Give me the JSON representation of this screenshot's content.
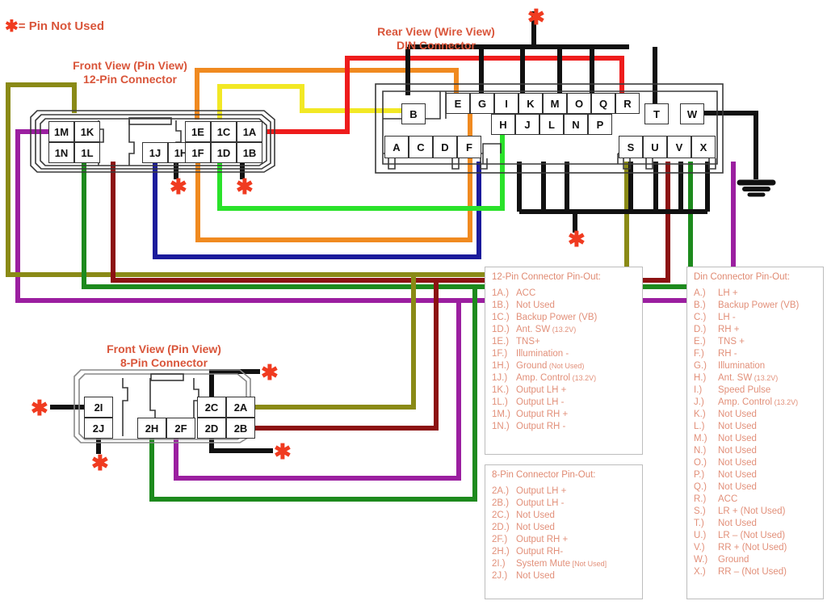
{
  "legend_note": {
    "symbol": "✱",
    "text": "= Pin Not Used"
  },
  "titles": {
    "twelve_pin": [
      "Front View (Pin View)",
      "12-Pin Connector"
    ],
    "din": [
      "Rear View (Wire View)",
      "DIN Connector"
    ],
    "eight_pin": [
      "Front View (Pin View)",
      "8-Pin Connector"
    ]
  },
  "connectors": {
    "twelve_pin": {
      "name": "12-Pin Connector",
      "pins": [
        "1M",
        "1K",
        "1N",
        "1L",
        "1J",
        "1H",
        "1E",
        "1C",
        "1A",
        "1F",
        "1D",
        "1B"
      ]
    },
    "din": {
      "name": "DIN Connector",
      "row_top": [
        "E",
        "G",
        "I",
        "K",
        "M",
        "O",
        "Q",
        "R"
      ],
      "row_top_right": [
        "T",
        "W"
      ],
      "row_mid_left": [
        "B"
      ],
      "row_mid": [
        "H",
        "J",
        "L",
        "N",
        "P"
      ],
      "row_bottom_left": [
        "A",
        "C",
        "D",
        "F"
      ],
      "row_bottom_right": [
        "S",
        "U",
        "V",
        "X"
      ]
    },
    "eight_pin": {
      "name": "8-Pin Connector",
      "pins": [
        "2I",
        "2J",
        "2H",
        "2F",
        "2C",
        "2A",
        "2D",
        "2B"
      ]
    }
  },
  "pinouts": {
    "twelve_pin": {
      "title": "12-Pin Connector Pin-Out:",
      "rows": [
        {
          "key": "1A.)",
          "val": "ACC",
          "note": ""
        },
        {
          "key": "1B.)",
          "val": "Not Used",
          "note": ""
        },
        {
          "key": "1C.)",
          "val": "Backup Power (VB)",
          "note": ""
        },
        {
          "key": "1D.)",
          "val": "Ant. SW",
          "note": "(13.2V)"
        },
        {
          "key": "1E.)",
          "val": "TNS+",
          "note": ""
        },
        {
          "key": "1F.)",
          "val": "Illumination -",
          "note": ""
        },
        {
          "key": "1H.)",
          "val": "Ground",
          "note": "(Not Used)"
        },
        {
          "key": "1J.)",
          "val": "Amp. Control",
          "note": "(13.2V)"
        },
        {
          "key": "1K.)",
          "val": "Output LH +",
          "note": ""
        },
        {
          "key": "1L.)",
          "val": "Output LH -",
          "note": ""
        },
        {
          "key": "1M.)",
          "val": "Output RH +",
          "note": ""
        },
        {
          "key": "1N.)",
          "val": "Output RH -",
          "note": ""
        }
      ]
    },
    "eight_pin": {
      "title": "8-Pin Connector Pin-Out:",
      "rows": [
        {
          "key": "2A.)",
          "val": "Output LH +",
          "note": ""
        },
        {
          "key": "2B.)",
          "val": "Output LH -",
          "note": ""
        },
        {
          "key": "2C.)",
          "val": "Not Used",
          "note": ""
        },
        {
          "key": "2D.)",
          "val": "Not Used",
          "note": ""
        },
        {
          "key": "2F.)",
          "val": "Output RH +",
          "note": ""
        },
        {
          "key": "2H.)",
          "val": "Output RH-",
          "note": ""
        },
        {
          "key": "2I.)",
          "val": "System Mute",
          "note": "[Not Used]"
        },
        {
          "key": "2J.)",
          "val": "Not Used",
          "note": ""
        }
      ]
    },
    "din": {
      "title": "Din Connector Pin-Out:",
      "rows": [
        {
          "key": "A.)",
          "val": "LH +",
          "note": ""
        },
        {
          "key": "B.)",
          "val": "Backup Power (VB)",
          "note": ""
        },
        {
          "key": "C.)",
          "val": "LH -",
          "note": ""
        },
        {
          "key": "D.)",
          "val": "RH +",
          "note": ""
        },
        {
          "key": "E.)",
          "val": "TNS +",
          "note": ""
        },
        {
          "key": "F.)",
          "val": "RH -",
          "note": ""
        },
        {
          "key": "G.)",
          "val": "Illumination",
          "note": ""
        },
        {
          "key": "H.)",
          "val": "Ant. SW",
          "note": "(13.2V)"
        },
        {
          "key": "I.)",
          "val": "Speed Pulse",
          "note": ""
        },
        {
          "key": "J.)",
          "val": "Amp. Control",
          "note": "(13.2V)"
        },
        {
          "key": "K.)",
          "val": "Not Used",
          "note": ""
        },
        {
          "key": "L.)",
          "val": "Not Used",
          "note": ""
        },
        {
          "key": "M.)",
          "val": "Not Used",
          "note": ""
        },
        {
          "key": "N.)",
          "val": "Not Used",
          "note": ""
        },
        {
          "key": "O.)",
          "val": "Not Used",
          "note": ""
        },
        {
          "key": "P.)",
          "val": "Not Used",
          "note": ""
        },
        {
          "key": "Q.)",
          "val": "Not Used",
          "note": ""
        },
        {
          "key": "R.)",
          "val": "ACC",
          "note": ""
        },
        {
          "key": "S.)",
          "val": "LR + (Not Used)",
          "note": ""
        },
        {
          "key": "T.)",
          "val": "Not Used",
          "note": ""
        },
        {
          "key": "U.)",
          "val": "LR – (Not Used)",
          "note": ""
        },
        {
          "key": "V.)",
          "val": "RR + (Not Used)",
          "note": ""
        },
        {
          "key": "W.)",
          "val": "Ground",
          "note": ""
        },
        {
          "key": "X.)",
          "val": "RR – (Not Used)",
          "note": ""
        }
      ]
    }
  },
  "wire_colors": {
    "olive": "#8a8a16",
    "purple": "#9b1fa0",
    "green_dark": "#1d8a1d",
    "maroon": "#8c1212",
    "navy": "#1b1b9c",
    "black": "#111111",
    "orange": "#f08a20",
    "green_bright": "#2ae22a",
    "yellow": "#f2e825",
    "red": "#ee1c1c"
  },
  "connections": [
    {
      "from": "1M",
      "to": "A",
      "color": "olive"
    },
    {
      "from": "1N",
      "to": "C",
      "color": "maroon"
    },
    {
      "from": "1K",
      "to": "D",
      "color": "purple"
    },
    {
      "from": "1L",
      "to": "F",
      "color": "green_dark"
    },
    {
      "from": "1J",
      "to": "J",
      "color": "navy"
    },
    {
      "from": "1H",
      "to": "not-used",
      "color": "black"
    },
    {
      "from": "1E",
      "to": "E",
      "color": "orange"
    },
    {
      "from": "1C",
      "to": "B",
      "color": "yellow"
    },
    {
      "from": "1A",
      "to": "R",
      "color": "red"
    },
    {
      "from": "1F",
      "to": "G",
      "color": "orange"
    },
    {
      "from": "1D",
      "to": "H",
      "color": "green_bright"
    },
    {
      "from": "1B",
      "to": "not-used",
      "color": "black"
    },
    {
      "from": "W",
      "to": "ground",
      "color": "black"
    },
    {
      "from": "2A",
      "to": "1M-bus",
      "color": "olive"
    },
    {
      "from": "2B",
      "to": "1N-bus",
      "color": "maroon"
    },
    {
      "from": "2H",
      "to": "1L-bus",
      "color": "green_dark"
    },
    {
      "from": "2F",
      "to": "1K-bus",
      "color": "purple"
    },
    {
      "from": "2I",
      "to": "not-used",
      "color": "black"
    },
    {
      "from": "2J",
      "to": "not-used",
      "color": "black"
    },
    {
      "from": "2C",
      "to": "not-used",
      "color": "black"
    },
    {
      "from": "2D",
      "to": "not-used",
      "color": "black"
    }
  ]
}
